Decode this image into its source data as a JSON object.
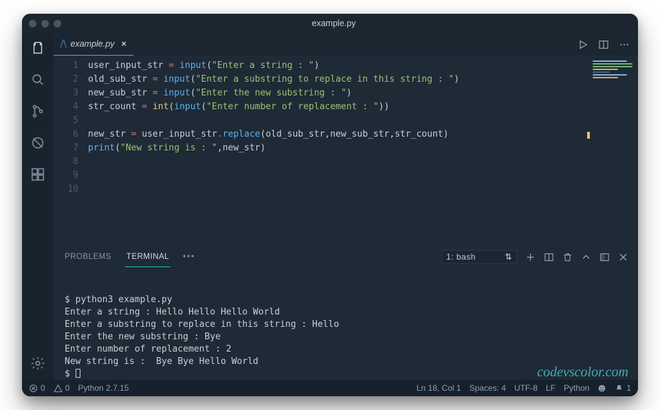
{
  "titlebar": {
    "title": "example.py"
  },
  "tabs": {
    "active": {
      "icon": "py",
      "label": "example.py"
    }
  },
  "code": {
    "lines": [
      {
        "n": 1,
        "tokens": [
          [
            "var",
            "user_input_str"
          ],
          [
            "sp",
            " "
          ],
          [
            "op",
            "="
          ],
          [
            "sp",
            " "
          ],
          [
            "fn",
            "input"
          ],
          [
            "punc",
            "("
          ],
          [
            "str",
            "\"Enter a string : \""
          ],
          [
            "punc",
            ")"
          ]
        ]
      },
      {
        "n": 2,
        "tokens": [
          [
            "var",
            "old_sub_str"
          ],
          [
            "sp",
            " "
          ],
          [
            "op",
            "="
          ],
          [
            "sp",
            " "
          ],
          [
            "fn",
            "input"
          ],
          [
            "punc",
            "("
          ],
          [
            "str",
            "\"Enter a substring to replace in this string : \""
          ],
          [
            "punc",
            ")"
          ]
        ]
      },
      {
        "n": 3,
        "tokens": [
          [
            "var",
            "new_sub_str"
          ],
          [
            "sp",
            " "
          ],
          [
            "op",
            "="
          ],
          [
            "sp",
            " "
          ],
          [
            "fn",
            "input"
          ],
          [
            "punc",
            "("
          ],
          [
            "str",
            "\"Enter the new substring : \""
          ],
          [
            "punc",
            ")"
          ]
        ]
      },
      {
        "n": 4,
        "tokens": [
          [
            "var",
            "str_count"
          ],
          [
            "sp",
            " "
          ],
          [
            "op",
            "="
          ],
          [
            "sp",
            " "
          ],
          [
            "kw",
            "int"
          ],
          [
            "punc",
            "("
          ],
          [
            "fn",
            "input"
          ],
          [
            "punc",
            "("
          ],
          [
            "str",
            "\"Enter number of replacement : \""
          ],
          [
            "punc",
            ")"
          ],
          [
            "punc",
            ")"
          ]
        ]
      },
      {
        "n": 5,
        "tokens": []
      },
      {
        "n": 6,
        "tokens": [
          [
            "var",
            "new_str"
          ],
          [
            "sp",
            " "
          ],
          [
            "op",
            "="
          ],
          [
            "sp",
            " "
          ],
          [
            "var",
            "user_input_str"
          ],
          [
            "dot",
            "."
          ],
          [
            "fn",
            "replace"
          ],
          [
            "punc",
            "("
          ],
          [
            "var",
            "old_sub_str"
          ],
          [
            "punc",
            ","
          ],
          [
            "var",
            "new_sub_str"
          ],
          [
            "punc",
            ","
          ],
          [
            "var",
            "str_count"
          ],
          [
            "punc",
            ")"
          ]
        ]
      },
      {
        "n": 7,
        "tokens": [
          [
            "fn",
            "print"
          ],
          [
            "punc",
            "("
          ],
          [
            "str",
            "\"New string is : \""
          ],
          [
            "punc",
            ","
          ],
          [
            "var",
            "new_str"
          ],
          [
            "punc",
            ")"
          ]
        ]
      },
      {
        "n": 8,
        "tokens": []
      },
      {
        "n": 9,
        "tokens": []
      },
      {
        "n": 10,
        "tokens": []
      }
    ]
  },
  "panel": {
    "tabs": {
      "problems": "PROBLEMS",
      "terminal": "TERMINAL"
    },
    "terminal_selector": "1: bash",
    "output_lines": [
      "$ python3 example.py",
      "Enter a string : Hello Hello Hello World",
      "Enter a substring to replace in this string : Hello",
      "Enter the new substring : Bye",
      "Enter number of replacement : 2",
      "New string is :  Bye Bye Hello World",
      "$ "
    ]
  },
  "watermark": "codevscolor.com",
  "status": {
    "errors": "0",
    "warnings": "0",
    "python_env": "Python 2.7.15",
    "position": "Ln 18, Col 1",
    "spaces": "Spaces: 4",
    "encoding": "UTF-8",
    "eol": "LF",
    "language": "Python",
    "bell": "1"
  }
}
